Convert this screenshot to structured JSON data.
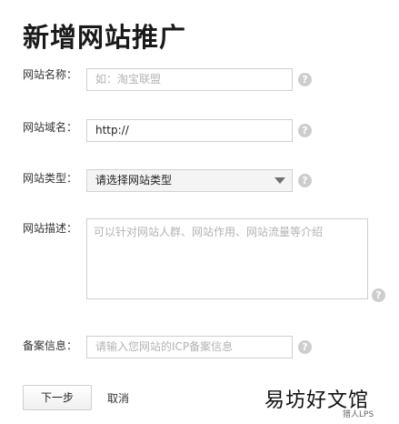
{
  "page": {
    "title": "新增网站推广"
  },
  "form": {
    "name": {
      "label": "网站名称：",
      "placeholder": "如：淘宝联盟"
    },
    "domain": {
      "label": "网站域名：",
      "value": "http://"
    },
    "type": {
      "label": "网站类型：",
      "selected": "请选择网站类型"
    },
    "description": {
      "label": "网站描述：",
      "placeholder": "可以针对网站人群、网站作用、网站流量等介绍"
    },
    "icp": {
      "label": "备案信息：",
      "placeholder": "请输入您网站的ICP备案信息"
    },
    "help_symbol": "?"
  },
  "actions": {
    "next_label": "下一步",
    "cancel_label": "取消"
  },
  "watermark": {
    "main": "易坊好文馆",
    "sub": "猎人LPS"
  }
}
